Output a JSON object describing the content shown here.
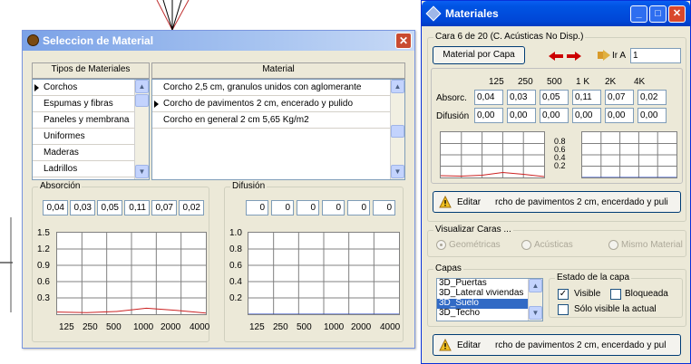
{
  "seleccion_dialog": {
    "title": "Seleccion de Material",
    "close_glyph": "✕",
    "tipos_header": "Tipos de Materiales",
    "material_header": "Material",
    "tipos": [
      "Corchos",
      "Espumas y fibras",
      "Paneles y membrana",
      "Uniformes",
      "Maderas",
      "Ladrillos"
    ],
    "tipos_selected": 0,
    "materials": [
      "Corcho 2,5 cm, granulos unidos con aglomerante",
      "Corcho de pavimentos 2 cm, encerado y pulido",
      "Corcho en general  2 cm 5,65 Kg/m2"
    ],
    "materials_selected": 1,
    "absorcion_label": "Absorción",
    "absorcion_values": [
      "0,04",
      "0,03",
      "0,05",
      "0,11",
      "0,07",
      "0,02"
    ],
    "difusion_label": "Difusión",
    "difusion_values": [
      "0",
      "0",
      "0",
      "0",
      "0",
      "0"
    ],
    "abs_y_labels": [
      "1.5",
      "1.2",
      "0.9",
      "0.6",
      "0.3"
    ],
    "dif_y_labels": [
      "1.0",
      "0.8",
      "0.6",
      "0.4",
      "0.2"
    ],
    "x_labels": [
      "125",
      "250",
      "500",
      "1000",
      "2000",
      "4000"
    ]
  },
  "materiales_window": {
    "title": "Materiales",
    "cara_group_label": "Cara 6 de 20 (C. Acústicas No Disp.)",
    "material_por_capa_label": "Material por Capa",
    "ir_a_label": "Ir A",
    "ir_a_value": "1",
    "freq_headers": [
      "125",
      "250",
      "500",
      "1 K",
      "2K",
      "4K"
    ],
    "absorc_label": "Absorc.",
    "absorc_values": [
      "0,04",
      "0,03",
      "0,05",
      "0,11",
      "0,07",
      "0,02"
    ],
    "difusion_label": "Difusión",
    "difusion_values": [
      "0,00",
      "0,00",
      "0,00",
      "0,00",
      "0,00",
      "0,00"
    ],
    "mini_graph_labels": [
      "0.8",
      "0.6",
      "0.4",
      "0.2"
    ],
    "editar_label": "Editar",
    "editar_material_text": "rcho de pavimentos 2 cm, encerdado y puli",
    "visualizar_label": "Visualizar Caras ...",
    "vis_options": [
      "Geométricas",
      "Acústicas",
      "Mismo Material"
    ],
    "vis_selected": 0,
    "capas_label": "Capas",
    "capas": [
      "3D_Puertas",
      "3D_Lateral viviendas",
      "3D_Suelo",
      "3D_Techo"
    ],
    "capas_selected": 2,
    "estado_label": "Estado de la capa",
    "visible_label": "Visible",
    "visible_checked": true,
    "bloqueada_label": "Bloqueada",
    "bloqueada_checked": false,
    "solo_visible_label": "Sólo visible la actual",
    "solo_visible_checked": false,
    "editar2_label": "Editar",
    "editar2_material_text": "rcho de pavimentos 2 cm, encerdado y pul"
  },
  "colors": {
    "curve_red": "#cc2222",
    "graph_blue": "#2040c0",
    "arrow_red": "#cc0000"
  }
}
